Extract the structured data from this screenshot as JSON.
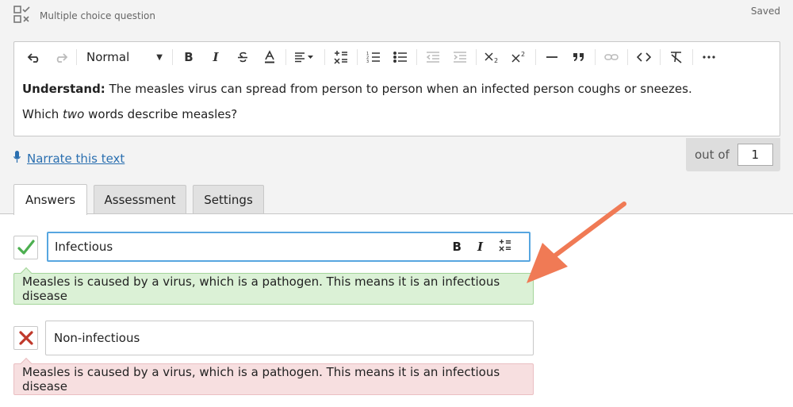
{
  "header": {
    "question_type": "Multiple choice question",
    "status": "Saved",
    "icon": "multiple-choice-icon"
  },
  "toolbar": {
    "format_value": "Normal",
    "buttons": [
      "undo-icon",
      "redo-icon",
      "bold-icon",
      "italic-icon",
      "strikethrough-icon",
      "text-color-icon",
      "align-icon",
      "math-icon",
      "ordered-list-icon",
      "bullet-list-icon",
      "outdent-icon",
      "indent-icon",
      "subscript-icon",
      "superscript-icon",
      "horizontal-rule-icon",
      "blockquote-icon",
      "link-icon",
      "code-icon",
      "clear-format-icon",
      "more-icon"
    ]
  },
  "content": {
    "line1_bold": "Understand:",
    "line1_rest": " The measles virus can spread from person to person when an infected person coughs or sneezes.",
    "line2_pre": "Which ",
    "line2_em": "two",
    "line2_post": " words describe measles?"
  },
  "narrate": {
    "label": "Narrate this text"
  },
  "score": {
    "label": "out of",
    "value": "1"
  },
  "tabs": [
    {
      "label": "Answers",
      "active": true
    },
    {
      "label": "Assessment",
      "active": false
    },
    {
      "label": "Settings",
      "active": false
    }
  ],
  "answers": [
    {
      "text": "Infectious",
      "correct": true,
      "feedback": "Measles is caused by a virus, which is a pathogen. This means it is an infectious disease"
    },
    {
      "text": "Non-infectious",
      "correct": false,
      "feedback": "Measles is caused by a virus, which is a pathogen. This means it is an infectious disease"
    }
  ],
  "colors": {
    "correct_green": "#4caf50",
    "wrong_red": "#c0392b",
    "focus_blue": "#57a6e0",
    "arrow_orange": "#f07a55",
    "link_blue": "#2a6fb0"
  }
}
